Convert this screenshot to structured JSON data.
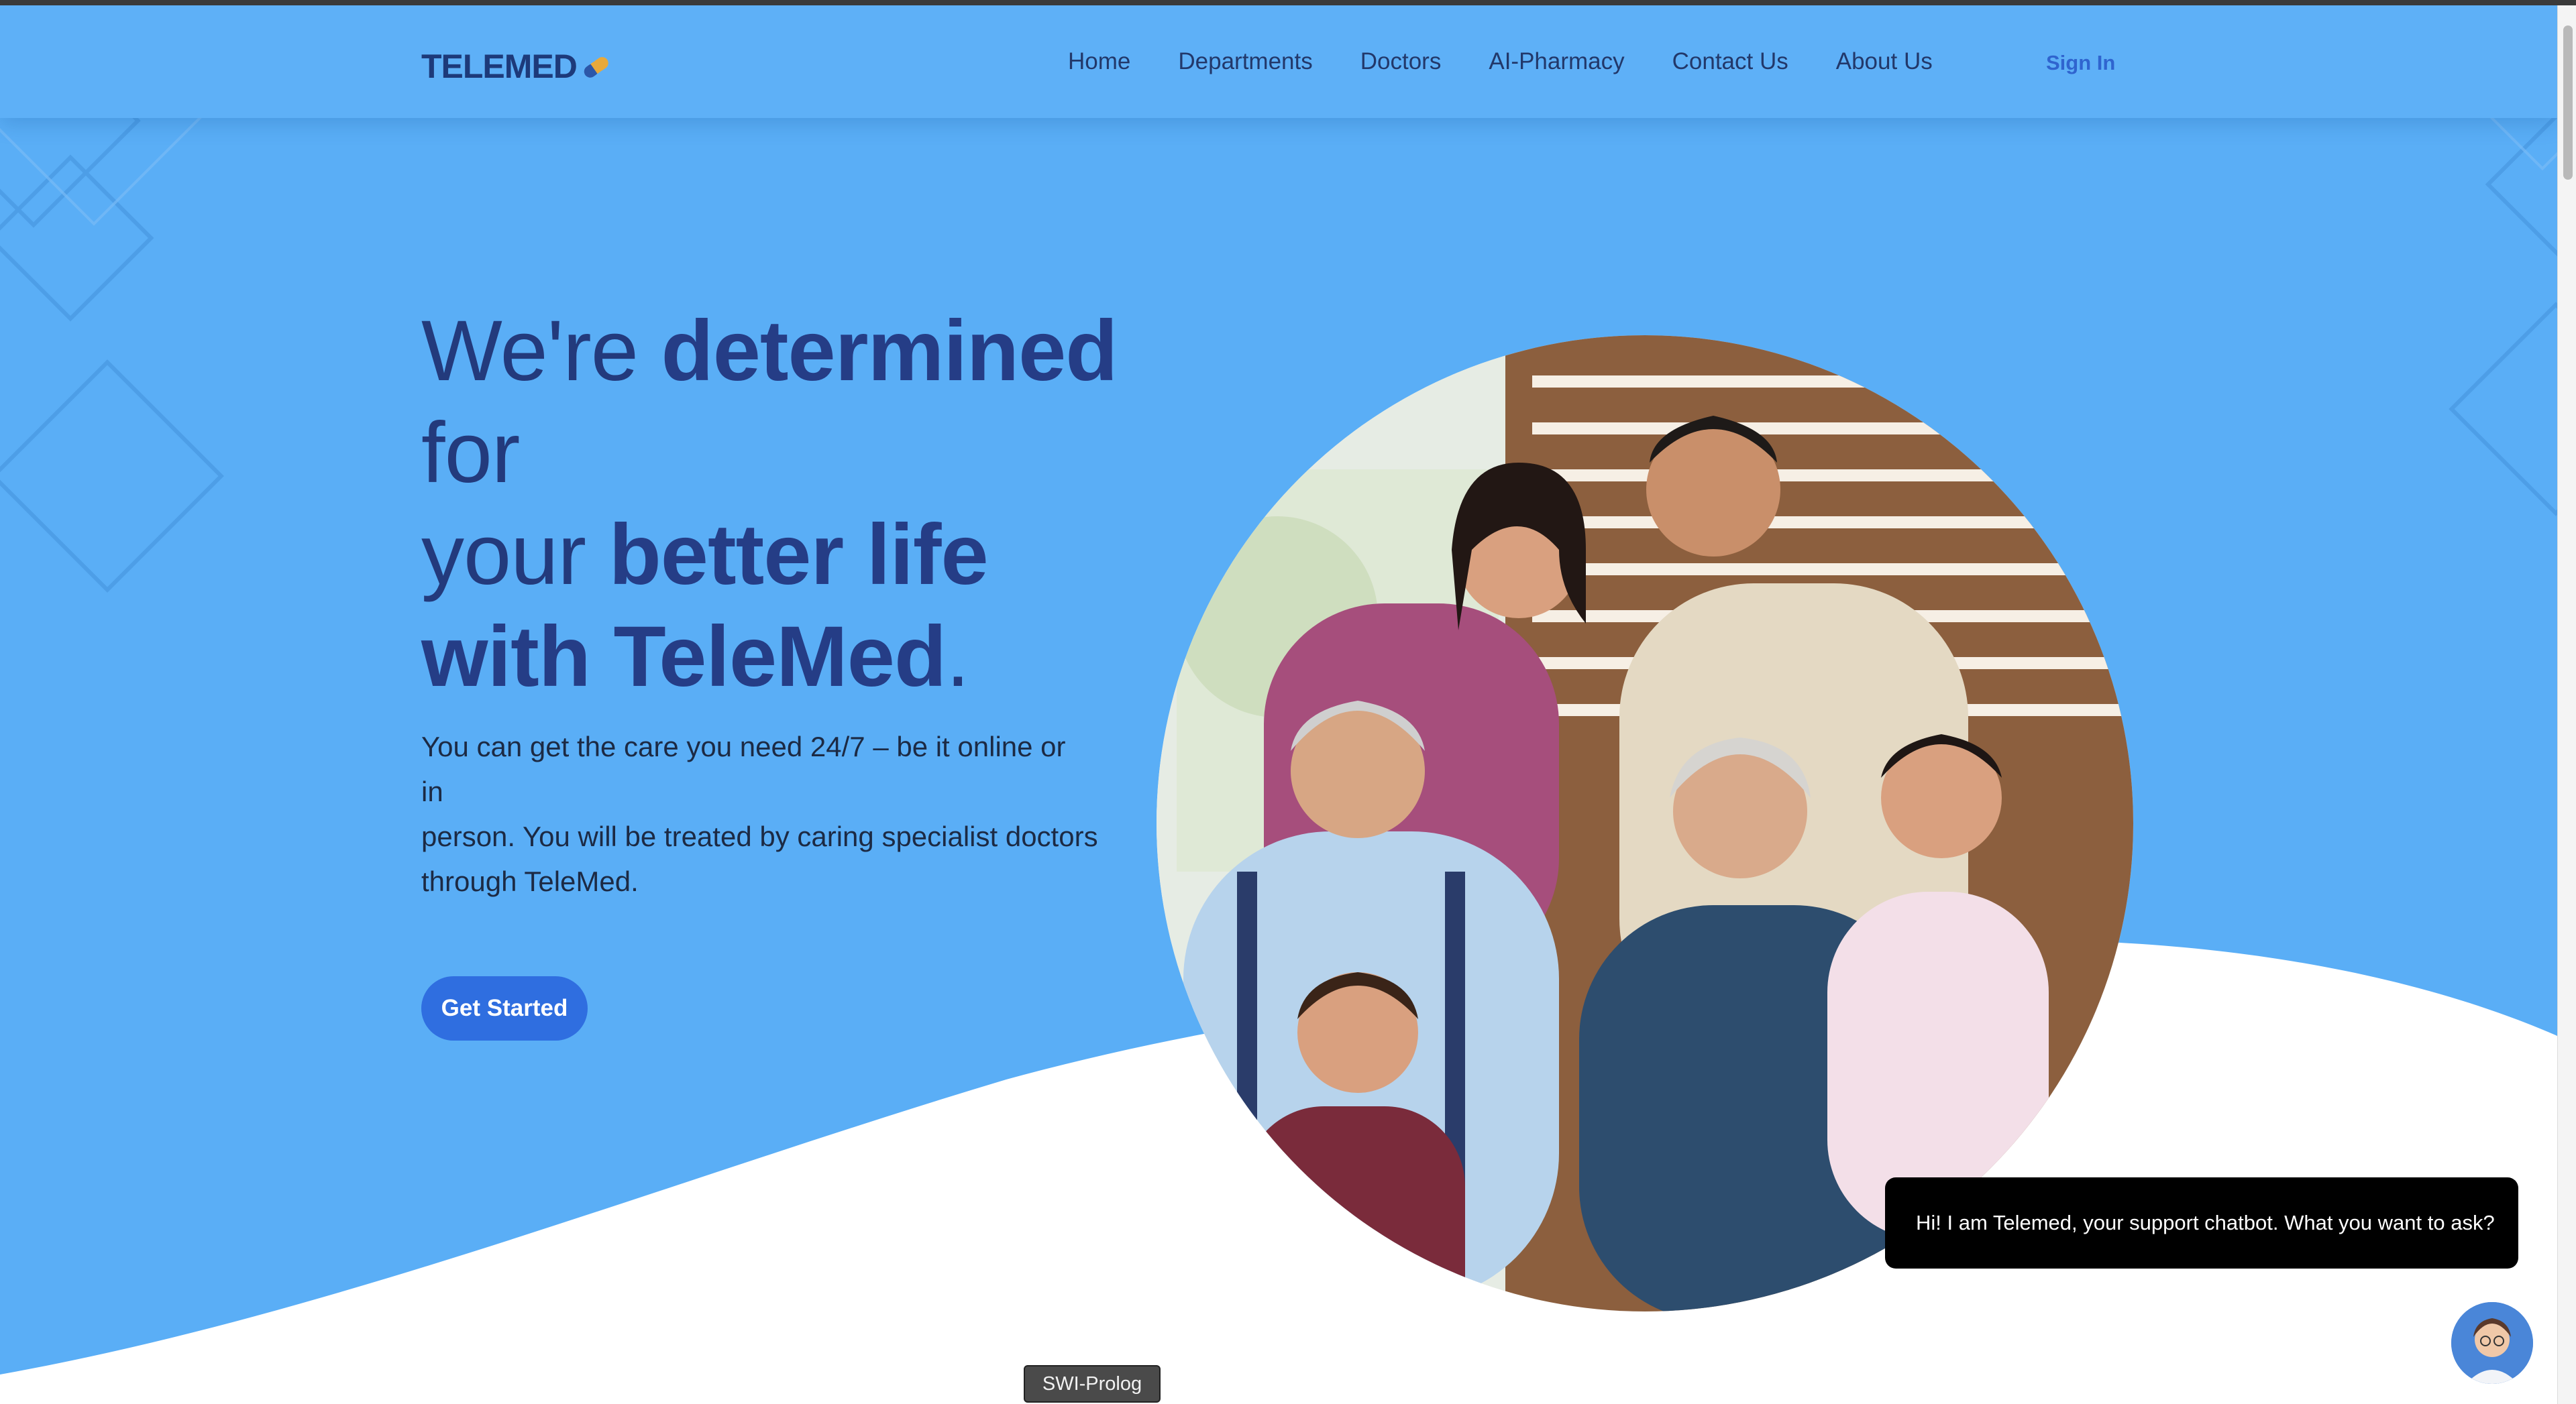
{
  "header": {
    "logo_text": "TELEMED",
    "nav": [
      "Home",
      "Departments",
      "Doctors",
      "AI-Pharmacy",
      "Contact Us",
      "About Us"
    ],
    "sign_in": "Sign In"
  },
  "hero": {
    "title_line1_light": "We're ",
    "title_line1_bold": "determined",
    "title_line2_light": "for",
    "title_line3_light": "your ",
    "title_line3_bold": "better life",
    "title_line4_bold": "with TeleMed",
    "title_line4_end": ".",
    "body_lines": [
      "You can get the care you need 24/7 – be it online or",
      "in",
      "person. You will be treated by caring specialist doctors",
      "through TeleMed."
    ],
    "cta_label": "Get Started"
  },
  "chat": {
    "message": "Hi! I am Telemed, your support chatbot. What you want to ask?"
  },
  "tooltip": "SWI-Prolog",
  "icons": {
    "logo": "capsule-icon",
    "chat_avatar": "doctor-avatar-icon"
  },
  "colors": {
    "hero_background": "#5aaef6",
    "heading": "#233a7c",
    "cta": "#2f6ee0",
    "sign_in": "#2f64cf",
    "chat_bubble": "#000000"
  }
}
